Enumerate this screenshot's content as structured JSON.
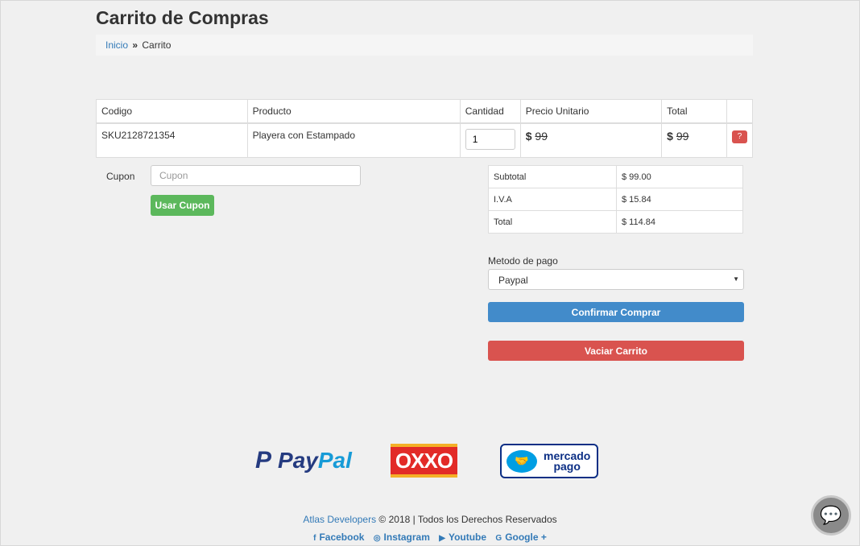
{
  "page": {
    "title": "Carrito de Compras"
  },
  "breadcrumb": {
    "home": "Inicio",
    "separator": "»",
    "current": "Carrito"
  },
  "cart": {
    "headers": [
      "Codigo",
      "Producto",
      "Cantidad",
      "Precio Unitario",
      "Total",
      ""
    ],
    "rows": [
      {
        "code": "SKU2128721354",
        "product": "Playera con Estampado",
        "quantity": "1",
        "unit_currency": "$ ",
        "unit_price": "99",
        "total_currency": "$ ",
        "total": "99",
        "delete_icon": "?"
      }
    ]
  },
  "coupon": {
    "label": "Cupon",
    "placeholder": "Cupon",
    "button": "Usar Cupon"
  },
  "totals": [
    {
      "label": "Subtotal",
      "value": "$ 99.00"
    },
    {
      "label": "I.V.A",
      "value": "$ 15.84"
    },
    {
      "label": "Total",
      "value": "$ 114.84"
    }
  ],
  "payment": {
    "label": "Metodo de pago",
    "selected": "Paypal",
    "caret": "▼"
  },
  "actions": {
    "confirm": "Confirmar Comprar",
    "empty": "Vaciar Carrito"
  },
  "logos": {
    "paypal_mark": "P",
    "paypal_1": "Pay",
    "paypal_2": "Pal",
    "oxxo": "OXXO",
    "mp_icon": "🤝",
    "mp_line1": "mercado",
    "mp_line2": "pago"
  },
  "footer": {
    "company": "Atlas Developers",
    "copyright": " © 2018 | Todos los Derechos Reservados",
    "social": [
      {
        "icon": "f",
        "label": "Facebook"
      },
      {
        "icon": "◎",
        "label": "Instagram"
      },
      {
        "icon": "▶",
        "label": "Youtube"
      },
      {
        "icon": "G",
        "label": "Google +"
      }
    ]
  },
  "chat": {
    "icon": "💬"
  },
  "colors": {
    "primary": "#428bca",
    "success": "#5cb85c",
    "danger": "#d9534f",
    "link": "#337ab7"
  }
}
